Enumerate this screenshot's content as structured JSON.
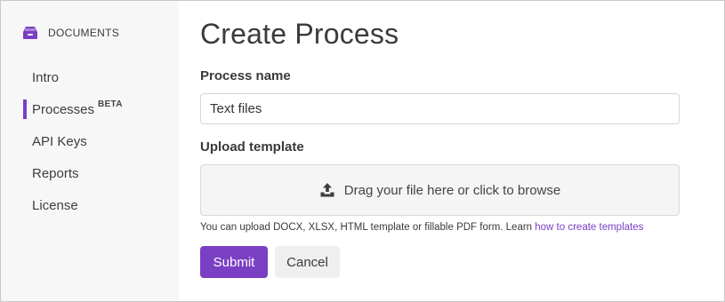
{
  "sidebar": {
    "brand_label": "DOCUMENTS",
    "brand_icon": "inbox-tray-icon",
    "items": [
      {
        "label": "Intro",
        "active": false
      },
      {
        "label": "Processes",
        "badge": "BETA",
        "active": true
      },
      {
        "label": "API Keys",
        "active": false
      },
      {
        "label": "Reports",
        "active": false
      },
      {
        "label": "License",
        "active": false
      }
    ]
  },
  "main": {
    "title": "Create Process",
    "process_name_label": "Process name",
    "process_name_value": "Text files",
    "upload_label": "Upload template",
    "upload_icon": "upload-icon",
    "dropzone_text": "Drag your file here or click to browse",
    "hint_text": "You can upload DOCX, XLSX, HTML template or fillable PDF form. Learn ",
    "hint_link": "how to create templates",
    "submit_label": "Submit",
    "cancel_label": "Cancel"
  },
  "colors": {
    "accent": "#7b3fc4",
    "sidebar_bg": "#f7f7f7",
    "dropzone_bg": "#f5f5f5",
    "cancel_bg": "#efefef"
  }
}
